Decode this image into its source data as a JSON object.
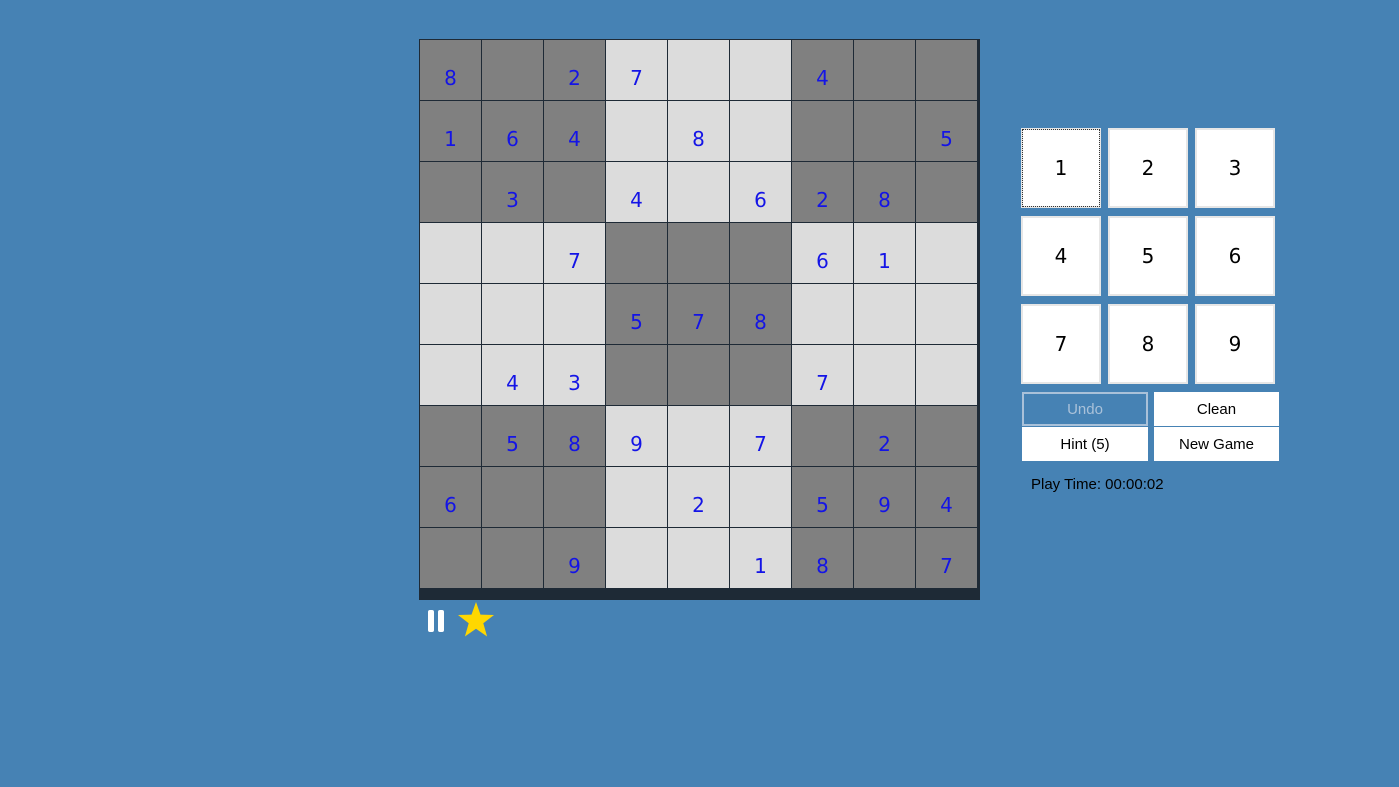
{
  "board": {
    "cells": [
      [
        "8",
        "",
        "2",
        "7",
        "",
        "",
        "4",
        "",
        ""
      ],
      [
        "1",
        "6",
        "4",
        "",
        "8",
        "",
        "",
        "",
        "5"
      ],
      [
        "",
        "3",
        "",
        "4",
        "",
        "6",
        "2",
        "8",
        ""
      ],
      [
        "",
        "",
        "7",
        "",
        "",
        "",
        "6",
        "1",
        ""
      ],
      [
        "",
        "",
        "",
        "5",
        "7",
        "8",
        "",
        "",
        ""
      ],
      [
        "",
        "4",
        "3",
        "",
        "",
        "",
        "7",
        "",
        ""
      ],
      [
        "",
        "5",
        "8",
        "9",
        "",
        "7",
        "",
        "2",
        ""
      ],
      [
        "6",
        "",
        "",
        "",
        "2",
        "",
        "5",
        "9",
        "4"
      ],
      [
        "",
        "",
        "9",
        "",
        "",
        "1",
        "8",
        "",
        "7"
      ]
    ],
    "colors": {
      "light_cell": "#dcdcdc",
      "dark_cell": "#808080",
      "digit": "#1414e6",
      "grid_line": "#1e2a36",
      "background": "#4682b4"
    }
  },
  "controls": {
    "pause_icon": "pause-icon",
    "star_icon": "star-icon",
    "star_color": "#ffd700"
  },
  "numpad": {
    "keys": [
      "1",
      "2",
      "3",
      "4",
      "5",
      "6",
      "7",
      "8",
      "9"
    ],
    "focused_key": "1"
  },
  "actions": {
    "undo_label": "Undo",
    "undo_enabled": false,
    "clean_label": "Clean",
    "hint_label": "Hint (5)",
    "new_game_label": "New Game"
  },
  "status": {
    "play_time_label": "Play Time: 00:00:02"
  }
}
